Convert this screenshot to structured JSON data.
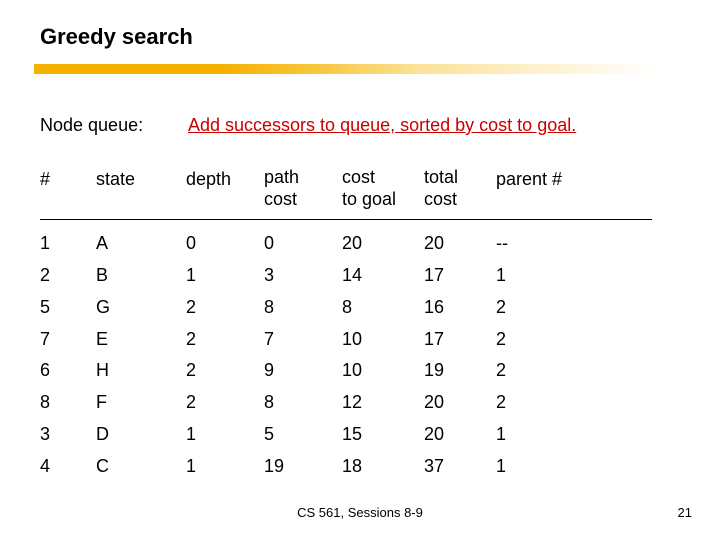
{
  "title": "Greedy search",
  "intro": {
    "label": "Node queue:",
    "text": "Add successors to queue, sorted by cost to goal."
  },
  "headers": {
    "num": "#",
    "state": "state",
    "depth": "depth",
    "path_cost_l1": "path",
    "path_cost_l2": "cost",
    "cost_goal_l1": "cost",
    "cost_goal_l2": "to goal",
    "total_cost_l1": "total",
    "total_cost_l2": "cost",
    "parent": "parent #"
  },
  "chart_data": {
    "type": "table",
    "columns": [
      "#",
      "state",
      "depth",
      "path cost",
      "cost to goal",
      "total cost",
      "parent #"
    ],
    "rows": [
      {
        "num": "1",
        "state": "A",
        "depth": "0",
        "path_cost": "0",
        "cost_to_goal": "20",
        "total_cost": "20",
        "parent": "--"
      },
      {
        "num": "2",
        "state": "B",
        "depth": "1",
        "path_cost": "3",
        "cost_to_goal": "14",
        "total_cost": "17",
        "parent": "1"
      },
      {
        "num": "5",
        "state": "G",
        "depth": "2",
        "path_cost": "8",
        "cost_to_goal": "8",
        "total_cost": "16",
        "parent": "2"
      },
      {
        "num": "7",
        "state": "E",
        "depth": "2",
        "path_cost": "7",
        "cost_to_goal": "10",
        "total_cost": "17",
        "parent": "2"
      },
      {
        "num": "6",
        "state": "H",
        "depth": "2",
        "path_cost": "9",
        "cost_to_goal": "10",
        "total_cost": "19",
        "parent": "2"
      },
      {
        "num": "8",
        "state": "F",
        "depth": "2",
        "path_cost": "8",
        "cost_to_goal": "12",
        "total_cost": "20",
        "parent": "2"
      },
      {
        "num": "3",
        "state": "D",
        "depth": "1",
        "path_cost": "5",
        "cost_to_goal": "15",
        "total_cost": "20",
        "parent": "1"
      },
      {
        "num": "4",
        "state": "C",
        "depth": "1",
        "path_cost": "19",
        "cost_to_goal": "18",
        "total_cost": "37",
        "parent": "1"
      }
    ]
  },
  "footer": {
    "center": "CS 561, Sessions 8-9",
    "right": "21"
  }
}
